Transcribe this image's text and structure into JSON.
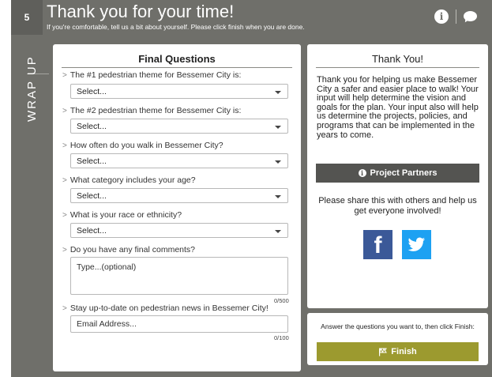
{
  "header": {
    "step_number": "5",
    "title": "Thank you for your time!",
    "subtitle": "If you're comfortable, tell us a bit about yourself. Please click finish when you are done.",
    "icons": [
      "info-icon",
      "chat-icon"
    ]
  },
  "sidebar": {
    "section_label": "WRAP UP"
  },
  "final_questions": {
    "title": "Final Questions",
    "questions": [
      {
        "label": "The #1 pedestrian theme for Bessemer City is:",
        "selected": "Select..."
      },
      {
        "label": "The #2 pedestrian theme for Bessemer City is:",
        "selected": "Select..."
      },
      {
        "label": "How often do you walk in Bessemer City?",
        "selected": "Select..."
      },
      {
        "label": "What category includes your age?",
        "selected": "Select..."
      },
      {
        "label": "What is your race or ethnicity?",
        "selected": "Select..."
      }
    ],
    "comments": {
      "label": "Do you have any final comments?",
      "placeholder": "Type...(optional)",
      "counter": "0/500"
    },
    "email": {
      "label": "Stay up-to-date on pedestrian news in Bessemer City!",
      "placeholder": "Email Address...",
      "counter": "0/100"
    }
  },
  "thank_you": {
    "title": "Thank You!",
    "body": "Thank you for helping us make Bessemer City a safer and easier place to walk! Your input will help determine the vision and goals for the plan. Your input also will help us determine the projects, policies, and programs that can be implemented in the years to come.",
    "partners_button": "Project Partners",
    "share_text": "Please share this with others and help us get everyone involved!",
    "social": [
      "facebook-icon",
      "twitter-icon"
    ]
  },
  "finish": {
    "message": "Answer the questions you want to, then click Finish:",
    "button": "Finish"
  },
  "colors": {
    "frame": "#6f6f6a",
    "finish_button": "#9c9a2f",
    "partners_button": "#545451",
    "facebook": "#3b5998",
    "twitter": "#1da1f2"
  }
}
